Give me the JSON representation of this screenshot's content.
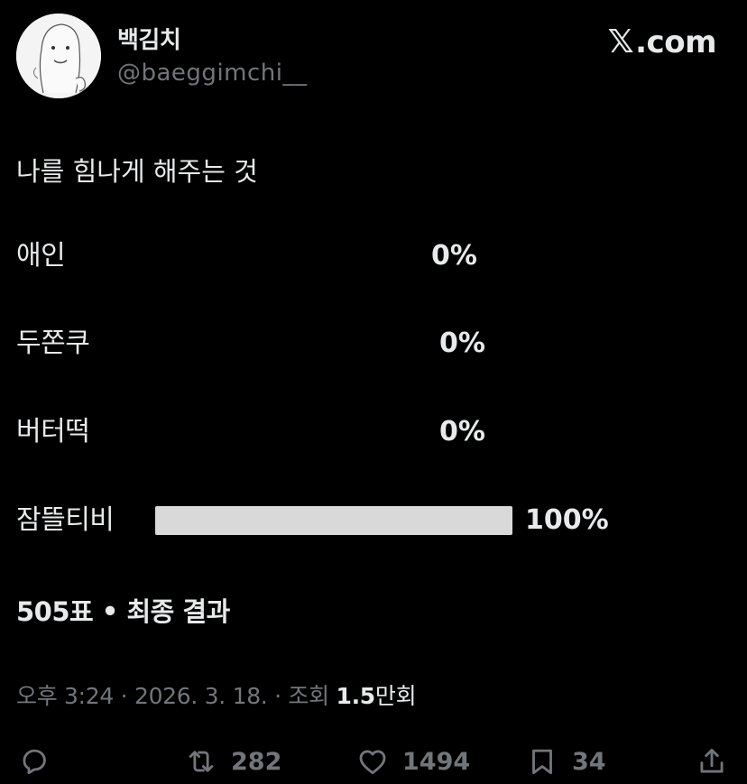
{
  "author": {
    "display_name": "백김치",
    "handle": "@baeggimchi__"
  },
  "brand": {
    "logo_text": ".com"
  },
  "poll": {
    "question": "나를 힘나게 해주는 것",
    "options": [
      {
        "label": "애인",
        "percent": "0%",
        "fraction": 0
      },
      {
        "label": "두쫀쿠",
        "percent": "0%",
        "fraction": 0
      },
      {
        "label": "버터떡",
        "percent": "0%",
        "fraction": 0
      },
      {
        "label": "잠뜰티비",
        "percent": "100%",
        "fraction": 1
      }
    ],
    "summary": "505표 • 최종 결과"
  },
  "meta": {
    "time": "오후 3:24",
    "date": "2026. 3. 18.",
    "views_label": "조회",
    "views_number": "1.5",
    "views_unit": "만회",
    "separator": "·"
  },
  "actions": {
    "reply_count": "",
    "retweet_count": "282",
    "like_count": "1494",
    "bookmark_count": "34"
  },
  "colors": {
    "background": "#000000",
    "text_primary": "#e7e9ea",
    "text_secondary": "#71767b",
    "poll_bar": "#d9d9d9"
  }
}
